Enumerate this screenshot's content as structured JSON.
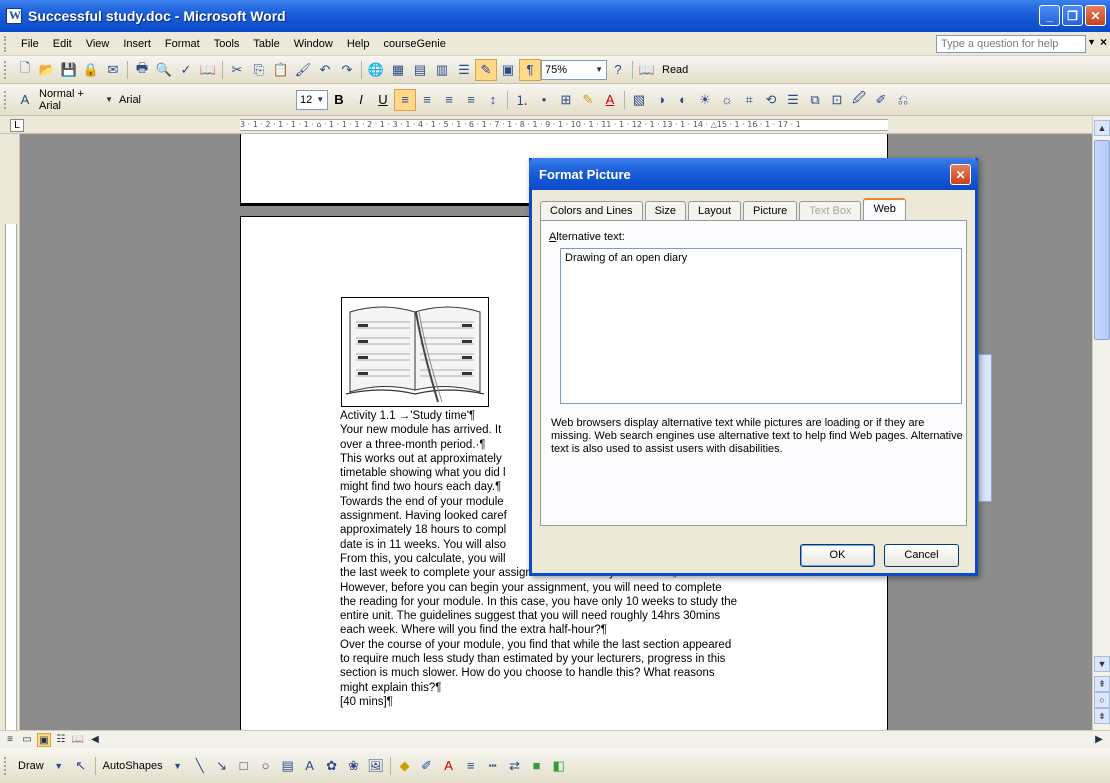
{
  "window": {
    "title": "Successful study.doc - Microsoft Word"
  },
  "menu": {
    "items": [
      "File",
      "Edit",
      "View",
      "Insert",
      "Format",
      "Tools",
      "Table",
      "Window",
      "Help",
      "courseGenie"
    ],
    "help_placeholder": "Type a question for help"
  },
  "standard_toolbar": {
    "zoom": "75%",
    "read_label": "Read"
  },
  "formatting_toolbar": {
    "style": "Normal + Arial",
    "font": "Arial",
    "size": "12"
  },
  "ruler": {
    "marks": "3 · 1 · 2 · 1 · 1 · 1 · ⌂ · 1 · 1 · 1 · 2 · 1 · 3 · 1 · 4 · 1 · 5 · 1 · 6 · 1 · 7 · 1 · 8 · 1 · 9 · 1 · 10 · 1 · 11 · 1 · 12 · 1 · 13 · 1 · 14 · △15 · 1 · 16 · 1 · 17 · 1"
  },
  "document": {
    "lines": [
      "Activity 1.1 →'Study time'¶",
      "Your new module has arrived. It",
      "over a three-month period.·¶",
      "This works out at approximately",
      "timetable showing what you did l",
      "might find two hours each day.¶",
      "Towards the end of your module",
      "assignment. Having looked caref",
      "approximately 18 hours to compl",
      "date is in 11 weeks. You will also",
      "From this, you calculate, you will",
      "the last week to complete your assignment. How will you do this?¶",
      "However, before you can begin your assignment, you will need to complete",
      "the reading for your module. In this case, you have only 10 weeks to study the",
      "entire unit. The guidelines suggest that you will need roughly 14hrs 30mins",
      "each week. Where will you find the extra half-hour?¶",
      "Over the course of your module, you find that while the last section appeared",
      "to require much less study than estimated by your lecturers, progress in this",
      "section is much slower. How do you choose to handle this? What reasons",
      "might explain this?¶",
      "[40 mins]¶"
    ]
  },
  "dialog": {
    "title": "Format Picture",
    "tabs": [
      {
        "label": "Colors and Lines",
        "state": "normal"
      },
      {
        "label": "Size",
        "state": "normal"
      },
      {
        "label": "Layout",
        "state": "normal"
      },
      {
        "label": "Picture",
        "state": "normal"
      },
      {
        "label": "Text Box",
        "state": "disabled"
      },
      {
        "label": "Web",
        "state": "active"
      }
    ],
    "alt_label_prefix": "A",
    "alt_label_rest": "lternative text:",
    "alt_text_value": "Drawing of an open diary",
    "description": "Web browsers display alternative text while pictures are loading or if they are missing.   Web search engines use alternative text to help find Web pages.  Alternative text is also used to assist users with disabilities.",
    "ok_label": "OK",
    "cancel_label": "Cancel"
  },
  "drawing_toolbar": {
    "draw_label": "Draw",
    "autoshapes_label": "AutoShapes"
  },
  "colors": {
    "titlebar": "#0a4ac9",
    "chrome": "#ece9d8",
    "close": "#c8411c",
    "tab_accent": "#e68b2c"
  }
}
